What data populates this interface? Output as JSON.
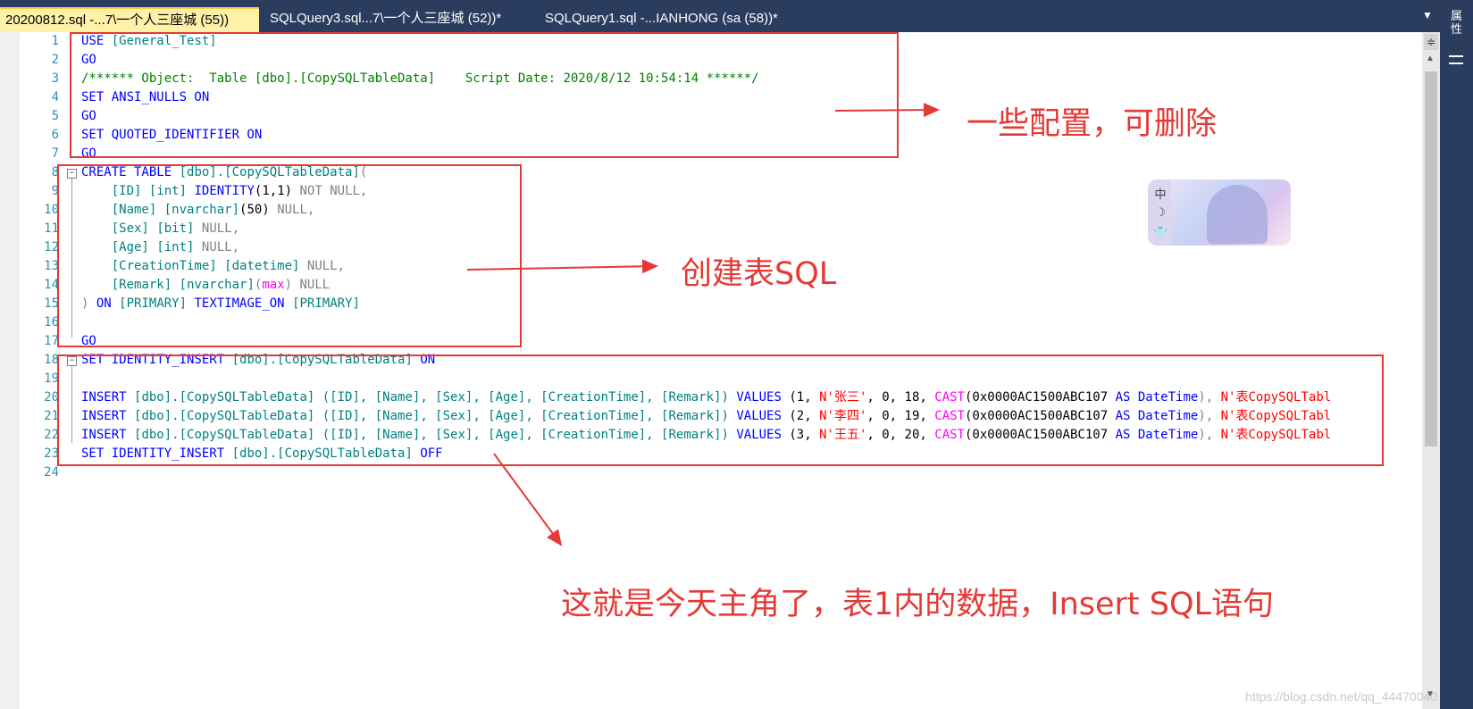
{
  "tabs": [
    {
      "label": "20200812.sql -...7\\一个人三座城 (55))",
      "active": true
    },
    {
      "label": "SQLQuery3.sql...7\\一个人三座城 (52))*",
      "active": false
    },
    {
      "label": "SQLQuery1.sql -...IANHONG (sa (58))*",
      "active": false
    }
  ],
  "tab_dropdown_icon": "chevron-down-icon",
  "side_panel": {
    "label": "属性"
  },
  "editor": {
    "line_numbers": [
      "1",
      "2",
      "3",
      "4",
      "5",
      "6",
      "7",
      "8",
      "9",
      "10",
      "11",
      "12",
      "13",
      "14",
      "15",
      "16",
      "17",
      "18",
      "19",
      "20",
      "21",
      "22",
      "23",
      "24"
    ],
    "line1": {
      "kw1": "USE",
      "id": "[General_Test]"
    },
    "go": "GO",
    "line3_comment": "/****** Object:  Table [dbo].[CopySQLTableData]    Script Date: 2020/8/12 10:54:14 ******/",
    "line4": {
      "kw": "SET ANSI_NULLS ON"
    },
    "line6": {
      "kw": "SET QUOTED_IDENTIFIER ON"
    },
    "line8": {
      "kw": "CREATE TABLE",
      "obj": "[dbo].[CopySQLTableData]",
      "paren": "("
    },
    "line9": {
      "col": "[ID]",
      "type": "[int]",
      "kw": "IDENTITY",
      "args": "(1,1)",
      "null": "NOT NULL,"
    },
    "line10": {
      "col": "[Name]",
      "type": "[nvarchar]",
      "args": "(50)",
      "null": "NULL,"
    },
    "line11": {
      "col": "[Sex]",
      "type": "[bit]",
      "null": "NULL,"
    },
    "line12": {
      "col": "[Age]",
      "type": "[int]",
      "null": "NULL,"
    },
    "line13": {
      "col": "[CreationTime]",
      "type": "[datetime]",
      "null": "NULL,"
    },
    "line14": {
      "col": "[Remark]",
      "type": "[nvarchar]",
      "open": "(",
      "max": "max",
      "close": ")",
      "null": "NULL"
    },
    "line15": {
      "close": ")",
      "on": "ON",
      "primary": "[PRIMARY]",
      "textimage": "TEXTIMAGE_ON",
      "primary2": "[PRIMARY]"
    },
    "identity_on": {
      "kw": "SET IDENTITY_INSERT",
      "obj": "[dbo].[CopySQLTableData]",
      "state": "ON"
    },
    "identity_off": {
      "kw": "SET IDENTITY_INSERT",
      "obj": "[dbo].[CopySQLTableData]",
      "state": "OFF"
    },
    "insert_rows": [
      {
        "insert": "INSERT",
        "obj": "[dbo].[CopySQLTableData]",
        "cols": "([ID], [Name], [Sex], [Age], [CreationTime], [Remark])",
        "values_kw": "VALUES",
        "open": "(1,",
        "name": "N'张三'",
        "sex_age": ", 0, 18,",
        "cast": "CAST",
        "hex": "(0x0000AC1500ABC107",
        "as": "AS",
        "dt": "DateTime",
        "comma": "),",
        "remark": "N'表CopySQLTabl"
      },
      {
        "insert": "INSERT",
        "obj": "[dbo].[CopySQLTableData]",
        "cols": "([ID], [Name], [Sex], [Age], [CreationTime], [Remark])",
        "values_kw": "VALUES",
        "open": "(2,",
        "name": "N'李四'",
        "sex_age": ", 0, 19,",
        "cast": "CAST",
        "hex": "(0x0000AC1500ABC107",
        "as": "AS",
        "dt": "DateTime",
        "comma": "),",
        "remark": "N'表CopySQLTabl"
      },
      {
        "insert": "INSERT",
        "obj": "[dbo].[CopySQLTableData]",
        "cols": "([ID], [Name], [Sex], [Age], [CreationTime], [Remark])",
        "values_kw": "VALUES",
        "open": "(3,",
        "name": "N'王五'",
        "sex_age": ", 0, 20,",
        "cast": "CAST",
        "hex": "(0x0000AC1500ABC107",
        "as": "AS",
        "dt": "DateTime",
        "comma": "),",
        "remark": "N'表CopySQLTabl"
      }
    ]
  },
  "annotations": {
    "config": "一些配置，可删除",
    "create_table": "创建表SQL",
    "insert": "这就是今天主角了，表1内的数据，Insert SQL语句"
  },
  "widget": {
    "icon1": "中",
    "icon2": "☽",
    "icon3": "👕"
  },
  "watermark": "https://blog.csdn.net/qq_44470040",
  "colors": {
    "annotation_red": "#e53935",
    "tab_bar": "#2b3d5f",
    "active_tab": "#fff1a8",
    "keyword": "#0000ff",
    "comment": "#008000",
    "string": "#ff0000",
    "function": "#ff00ff",
    "identifier": "#008080",
    "line_number": "#2b91af"
  }
}
